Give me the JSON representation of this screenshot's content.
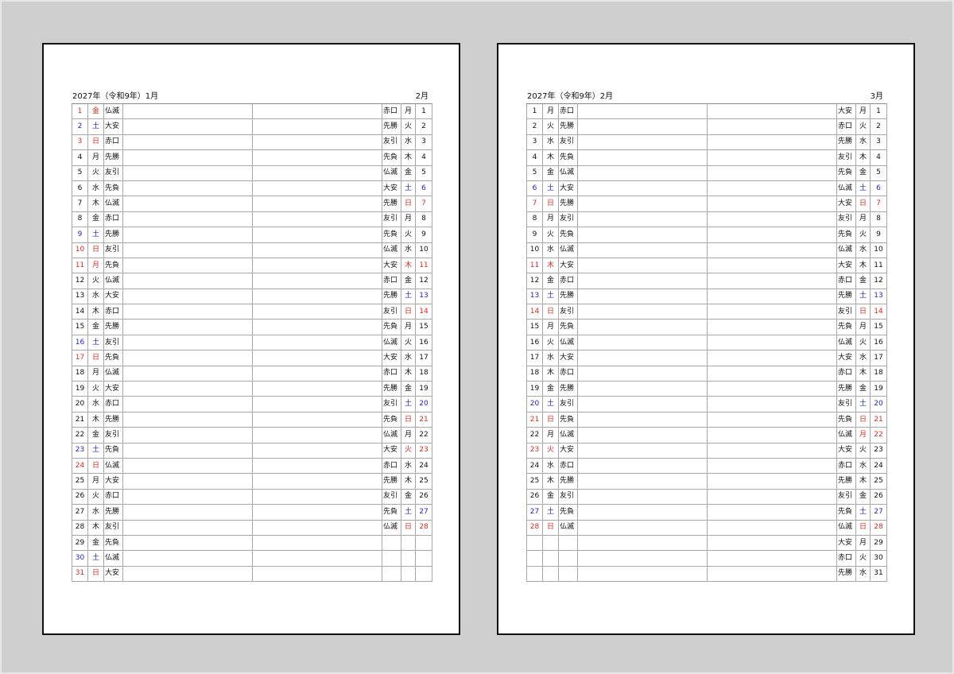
{
  "colors": {
    "sunday": "#e8281e",
    "saturday": "#2222dd",
    "holiday": "#e8281e",
    "background": "#d0cfcf"
  },
  "pages": [
    {
      "header_left": "2027年（令和9年）1月",
      "header_right": "2月",
      "rows": [
        {
          "d1": "1",
          "w1": "金",
          "r1": "仏滅",
          "c1": "hol",
          "r2": "赤口",
          "w2": "月",
          "d2": "1",
          "c2": ""
        },
        {
          "d1": "2",
          "w1": "土",
          "r1": "大安",
          "c1": "sat",
          "r2": "先勝",
          "w2": "火",
          "d2": "2",
          "c2": ""
        },
        {
          "d1": "3",
          "w1": "日",
          "r1": "赤口",
          "c1": "sun",
          "r2": "友引",
          "w2": "水",
          "d2": "3",
          "c2": ""
        },
        {
          "d1": "4",
          "w1": "月",
          "r1": "先勝",
          "c1": "",
          "r2": "先負",
          "w2": "木",
          "d2": "4",
          "c2": ""
        },
        {
          "d1": "5",
          "w1": "火",
          "r1": "友引",
          "c1": "",
          "r2": "仏滅",
          "w2": "金",
          "d2": "5",
          "c2": ""
        },
        {
          "d1": "6",
          "w1": "水",
          "r1": "先負",
          "c1": "",
          "r2": "大安",
          "w2": "土",
          "d2": "6",
          "c2": "sat"
        },
        {
          "d1": "7",
          "w1": "木",
          "r1": "仏滅",
          "c1": "",
          "r2": "先勝",
          "w2": "日",
          "d2": "7",
          "c2": "sun"
        },
        {
          "d1": "8",
          "w1": "金",
          "r1": "赤口",
          "c1": "",
          "r2": "友引",
          "w2": "月",
          "d2": "8",
          "c2": ""
        },
        {
          "d1": "9",
          "w1": "土",
          "r1": "先勝",
          "c1": "sat",
          "r2": "先負",
          "w2": "火",
          "d2": "9",
          "c2": ""
        },
        {
          "d1": "10",
          "w1": "日",
          "r1": "友引",
          "c1": "sun",
          "r2": "仏滅",
          "w2": "水",
          "d2": "10",
          "c2": ""
        },
        {
          "d1": "11",
          "w1": "月",
          "r1": "先負",
          "c1": "hol",
          "r2": "大安",
          "w2": "木",
          "d2": "11",
          "c2": "hol"
        },
        {
          "d1": "12",
          "w1": "火",
          "r1": "仏滅",
          "c1": "",
          "r2": "赤口",
          "w2": "金",
          "d2": "12",
          "c2": ""
        },
        {
          "d1": "13",
          "w1": "水",
          "r1": "大安",
          "c1": "",
          "r2": "先勝",
          "w2": "土",
          "d2": "13",
          "c2": "sat"
        },
        {
          "d1": "14",
          "w1": "木",
          "r1": "赤口",
          "c1": "",
          "r2": "友引",
          "w2": "日",
          "d2": "14",
          "c2": "sun"
        },
        {
          "d1": "15",
          "w1": "金",
          "r1": "先勝",
          "c1": "",
          "r2": "先負",
          "w2": "月",
          "d2": "15",
          "c2": ""
        },
        {
          "d1": "16",
          "w1": "土",
          "r1": "友引",
          "c1": "sat",
          "r2": "仏滅",
          "w2": "火",
          "d2": "16",
          "c2": ""
        },
        {
          "d1": "17",
          "w1": "日",
          "r1": "先負",
          "c1": "sun",
          "r2": "大安",
          "w2": "水",
          "d2": "17",
          "c2": ""
        },
        {
          "d1": "18",
          "w1": "月",
          "r1": "仏滅",
          "c1": "",
          "r2": "赤口",
          "w2": "木",
          "d2": "18",
          "c2": ""
        },
        {
          "d1": "19",
          "w1": "火",
          "r1": "大安",
          "c1": "",
          "r2": "先勝",
          "w2": "金",
          "d2": "19",
          "c2": ""
        },
        {
          "d1": "20",
          "w1": "水",
          "r1": "赤口",
          "c1": "",
          "r2": "友引",
          "w2": "土",
          "d2": "20",
          "c2": "sat"
        },
        {
          "d1": "21",
          "w1": "木",
          "r1": "先勝",
          "c1": "",
          "r2": "先負",
          "w2": "日",
          "d2": "21",
          "c2": "sun"
        },
        {
          "d1": "22",
          "w1": "金",
          "r1": "友引",
          "c1": "",
          "r2": "仏滅",
          "w2": "月",
          "d2": "22",
          "c2": ""
        },
        {
          "d1": "23",
          "w1": "土",
          "r1": "先負",
          "c1": "sat",
          "r2": "大安",
          "w2": "火",
          "d2": "23",
          "c2": "hol"
        },
        {
          "d1": "24",
          "w1": "日",
          "r1": "仏滅",
          "c1": "sun",
          "r2": "赤口",
          "w2": "水",
          "d2": "24",
          "c2": ""
        },
        {
          "d1": "25",
          "w1": "月",
          "r1": "大安",
          "c1": "",
          "r2": "先勝",
          "w2": "木",
          "d2": "25",
          "c2": ""
        },
        {
          "d1": "26",
          "w1": "火",
          "r1": "赤口",
          "c1": "",
          "r2": "友引",
          "w2": "金",
          "d2": "26",
          "c2": ""
        },
        {
          "d1": "27",
          "w1": "水",
          "r1": "先勝",
          "c1": "",
          "r2": "先負",
          "w2": "土",
          "d2": "27",
          "c2": "sat"
        },
        {
          "d1": "28",
          "w1": "木",
          "r1": "友引",
          "c1": "",
          "r2": "仏滅",
          "w2": "日",
          "d2": "28",
          "c2": "sun"
        },
        {
          "d1": "29",
          "w1": "金",
          "r1": "先負",
          "c1": "",
          "r2": "",
          "w2": "",
          "d2": "",
          "c2": ""
        },
        {
          "d1": "30",
          "w1": "土",
          "r1": "仏滅",
          "c1": "sat",
          "r2": "",
          "w2": "",
          "d2": "",
          "c2": ""
        },
        {
          "d1": "31",
          "w1": "日",
          "r1": "大安",
          "c1": "sun",
          "r2": "",
          "w2": "",
          "d2": "",
          "c2": ""
        }
      ]
    },
    {
      "header_left": "2027年（令和9年）2月",
      "header_right": "3月",
      "rows": [
        {
          "d1": "1",
          "w1": "月",
          "r1": "赤口",
          "c1": "",
          "r2": "大安",
          "w2": "月",
          "d2": "1",
          "c2": ""
        },
        {
          "d1": "2",
          "w1": "火",
          "r1": "先勝",
          "c1": "",
          "r2": "赤口",
          "w2": "火",
          "d2": "2",
          "c2": ""
        },
        {
          "d1": "3",
          "w1": "水",
          "r1": "友引",
          "c1": "",
          "r2": "先勝",
          "w2": "水",
          "d2": "3",
          "c2": ""
        },
        {
          "d1": "4",
          "w1": "木",
          "r1": "先負",
          "c1": "",
          "r2": "友引",
          "w2": "木",
          "d2": "4",
          "c2": ""
        },
        {
          "d1": "5",
          "w1": "金",
          "r1": "仏滅",
          "c1": "",
          "r2": "先負",
          "w2": "金",
          "d2": "5",
          "c2": ""
        },
        {
          "d1": "6",
          "w1": "土",
          "r1": "大安",
          "c1": "sat",
          "r2": "仏滅",
          "w2": "土",
          "d2": "6",
          "c2": "sat"
        },
        {
          "d1": "7",
          "w1": "日",
          "r1": "先勝",
          "c1": "sun",
          "r2": "大安",
          "w2": "日",
          "d2": "7",
          "c2": "sun"
        },
        {
          "d1": "8",
          "w1": "月",
          "r1": "友引",
          "c1": "",
          "r2": "友引",
          "w2": "月",
          "d2": "8",
          "c2": ""
        },
        {
          "d1": "9",
          "w1": "火",
          "r1": "先負",
          "c1": "",
          "r2": "先負",
          "w2": "火",
          "d2": "9",
          "c2": ""
        },
        {
          "d1": "10",
          "w1": "水",
          "r1": "仏滅",
          "c1": "",
          "r2": "仏滅",
          "w2": "水",
          "d2": "10",
          "c2": ""
        },
        {
          "d1": "11",
          "w1": "木",
          "r1": "大安",
          "c1": "hol",
          "r2": "大安",
          "w2": "木",
          "d2": "11",
          "c2": ""
        },
        {
          "d1": "12",
          "w1": "金",
          "r1": "赤口",
          "c1": "",
          "r2": "赤口",
          "w2": "金",
          "d2": "12",
          "c2": ""
        },
        {
          "d1": "13",
          "w1": "土",
          "r1": "先勝",
          "c1": "sat",
          "r2": "先勝",
          "w2": "土",
          "d2": "13",
          "c2": "sat"
        },
        {
          "d1": "14",
          "w1": "日",
          "r1": "友引",
          "c1": "sun",
          "r2": "友引",
          "w2": "日",
          "d2": "14",
          "c2": "sun"
        },
        {
          "d1": "15",
          "w1": "月",
          "r1": "先負",
          "c1": "",
          "r2": "先負",
          "w2": "月",
          "d2": "15",
          "c2": ""
        },
        {
          "d1": "16",
          "w1": "火",
          "r1": "仏滅",
          "c1": "",
          "r2": "仏滅",
          "w2": "火",
          "d2": "16",
          "c2": ""
        },
        {
          "d1": "17",
          "w1": "水",
          "r1": "大安",
          "c1": "",
          "r2": "大安",
          "w2": "水",
          "d2": "17",
          "c2": ""
        },
        {
          "d1": "18",
          "w1": "木",
          "r1": "赤口",
          "c1": "",
          "r2": "赤口",
          "w2": "木",
          "d2": "18",
          "c2": ""
        },
        {
          "d1": "19",
          "w1": "金",
          "r1": "先勝",
          "c1": "",
          "r2": "先勝",
          "w2": "金",
          "d2": "19",
          "c2": ""
        },
        {
          "d1": "20",
          "w1": "土",
          "r1": "友引",
          "c1": "sat",
          "r2": "友引",
          "w2": "土",
          "d2": "20",
          "c2": "sat"
        },
        {
          "d1": "21",
          "w1": "日",
          "r1": "先負",
          "c1": "sun",
          "r2": "先負",
          "w2": "日",
          "d2": "21",
          "c2": "sun"
        },
        {
          "d1": "22",
          "w1": "月",
          "r1": "仏滅",
          "c1": "",
          "r2": "仏滅",
          "w2": "月",
          "d2": "22",
          "c2": "hol"
        },
        {
          "d1": "23",
          "w1": "火",
          "r1": "大安",
          "c1": "hol",
          "r2": "大安",
          "w2": "火",
          "d2": "23",
          "c2": ""
        },
        {
          "d1": "24",
          "w1": "水",
          "r1": "赤口",
          "c1": "",
          "r2": "赤口",
          "w2": "水",
          "d2": "24",
          "c2": ""
        },
        {
          "d1": "25",
          "w1": "木",
          "r1": "先勝",
          "c1": "",
          "r2": "先勝",
          "w2": "木",
          "d2": "25",
          "c2": ""
        },
        {
          "d1": "26",
          "w1": "金",
          "r1": "友引",
          "c1": "",
          "r2": "友引",
          "w2": "金",
          "d2": "26",
          "c2": ""
        },
        {
          "d1": "27",
          "w1": "土",
          "r1": "先負",
          "c1": "sat",
          "r2": "先負",
          "w2": "土",
          "d2": "27",
          "c2": "sat"
        },
        {
          "d1": "28",
          "w1": "日",
          "r1": "仏滅",
          "c1": "sun",
          "r2": "仏滅",
          "w2": "日",
          "d2": "28",
          "c2": "sun"
        },
        {
          "d1": "",
          "w1": "",
          "r1": "",
          "c1": "",
          "r2": "大安",
          "w2": "月",
          "d2": "29",
          "c2": ""
        },
        {
          "d1": "",
          "w1": "",
          "r1": "",
          "c1": "",
          "r2": "赤口",
          "w2": "火",
          "d2": "30",
          "c2": ""
        },
        {
          "d1": "",
          "w1": "",
          "r1": "",
          "c1": "",
          "r2": "先勝",
          "w2": "水",
          "d2": "31",
          "c2": ""
        }
      ]
    }
  ]
}
